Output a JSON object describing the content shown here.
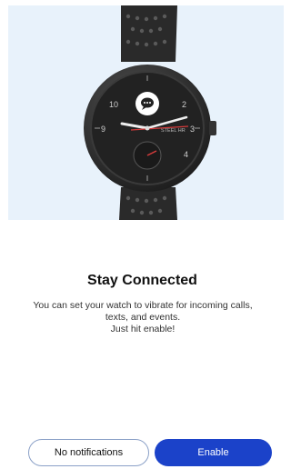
{
  "hero": {
    "image": "steel-hr-watch-illustration",
    "background_color": "#e8f2fb",
    "watch_dial_numbers": [
      "9",
      "10",
      "2",
      "3",
      "4"
    ],
    "watch_brand_text": "STEEL HR",
    "notification_icon": "chat-bubble-icon"
  },
  "content": {
    "title": "Stay Connected",
    "description_lines": [
      "You can set your watch to vibrate for incoming calls,",
      "texts, and events.",
      "Just hit enable!"
    ]
  },
  "actions": {
    "secondary_label": "No notifications",
    "primary_label": "Enable",
    "primary_color": "#1b42c9"
  }
}
